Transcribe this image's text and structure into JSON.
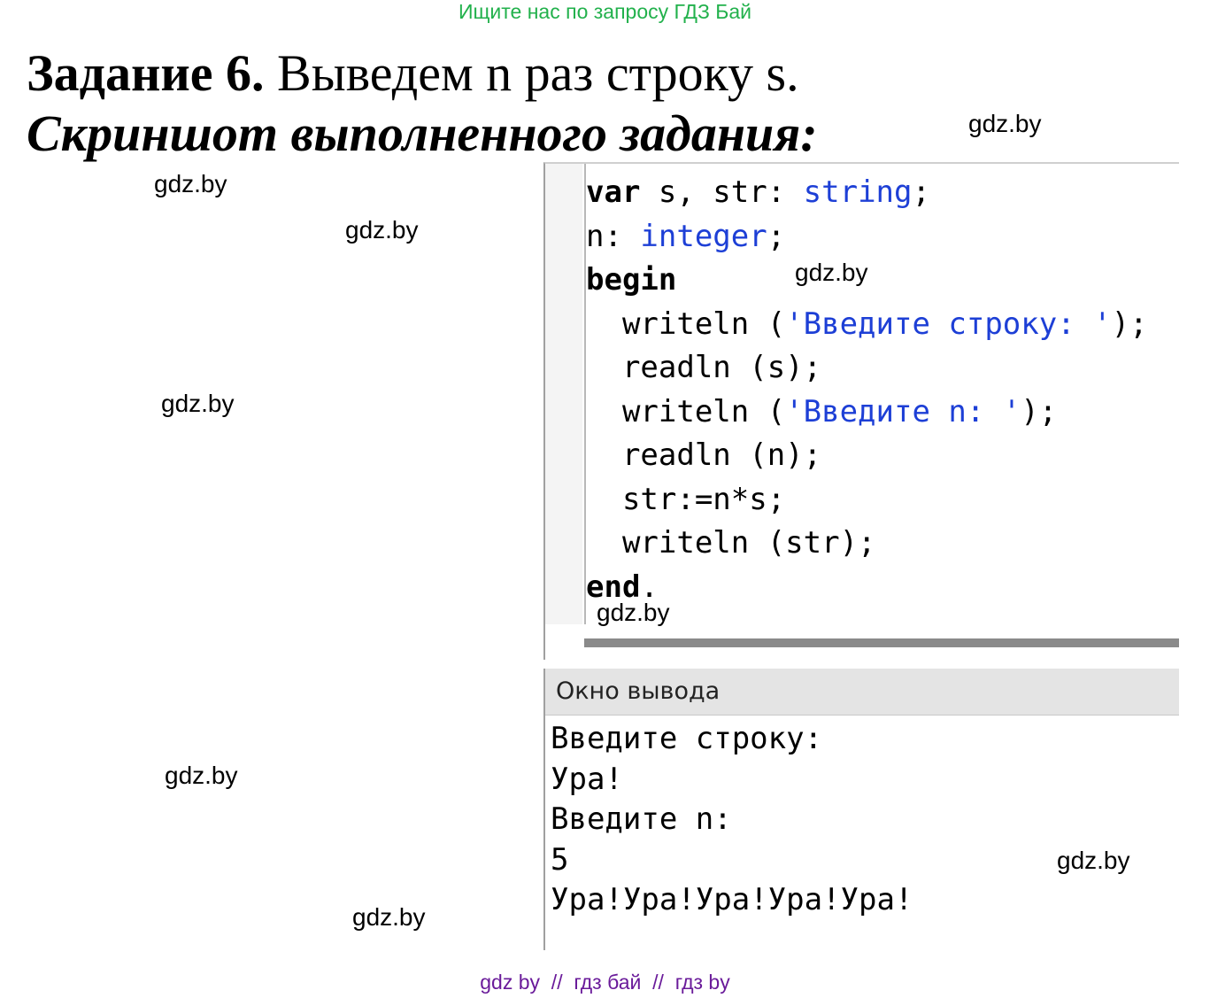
{
  "top_banner": "Ищите нас по запросу ГДЗ Бай",
  "heading": {
    "label": "Задание 6.",
    "text": " Выведем n раз строку s."
  },
  "caption": "Скриншот выполненного задания:",
  "watermarks": [
    "gdz.by",
    "gdz.by",
    "gdz.by",
    "gdz.by",
    "gdz.by",
    "gdz.by",
    "gdz.by",
    "gdz.by",
    "gdz.by"
  ],
  "editor": {
    "code": [
      {
        "tokens": [
          {
            "t": "var",
            "c": "kw"
          },
          {
            "t": " s, str: ",
            "c": ""
          },
          {
            "t": "string",
            "c": "ty"
          },
          {
            "t": ";",
            "c": ""
          }
        ]
      },
      {
        "tokens": [
          {
            "t": "n: ",
            "c": ""
          },
          {
            "t": "integer",
            "c": "ty"
          },
          {
            "t": ";",
            "c": ""
          }
        ]
      },
      {
        "tokens": [
          {
            "t": "begin",
            "c": "kw"
          }
        ]
      },
      {
        "tokens": [
          {
            "t": "  writeln (",
            "c": ""
          },
          {
            "t": "'Введите строку: '",
            "c": "st"
          },
          {
            "t": ");",
            "c": ""
          }
        ]
      },
      {
        "tokens": [
          {
            "t": "  readln (s);",
            "c": ""
          }
        ]
      },
      {
        "tokens": [
          {
            "t": "  writeln (",
            "c": ""
          },
          {
            "t": "'Введите n: '",
            "c": "st"
          },
          {
            "t": ");",
            "c": ""
          }
        ]
      },
      {
        "tokens": [
          {
            "t": "  readln (n);",
            "c": ""
          }
        ]
      },
      {
        "tokens": [
          {
            "t": "  str:=n*s;",
            "c": ""
          }
        ]
      },
      {
        "tokens": [
          {
            "t": "  writeln (str);",
            "c": ""
          }
        ]
      },
      {
        "tokens": [
          {
            "t": "end",
            "c": "kw"
          },
          {
            "t": ".",
            "c": ""
          }
        ]
      }
    ]
  },
  "output": {
    "title": "Окно вывода",
    "lines": [
      "Введите строку:",
      "Ура!",
      "Введите n:",
      "5",
      "Ура!Ура!Ура!Ура!Ура!"
    ]
  },
  "footer": "gdz by  //  гдз бай  //  гдз by",
  "colors": {
    "banner": "#22b14c",
    "keyword_type": "#1d3fd6",
    "footer": "#6a1b9a"
  }
}
